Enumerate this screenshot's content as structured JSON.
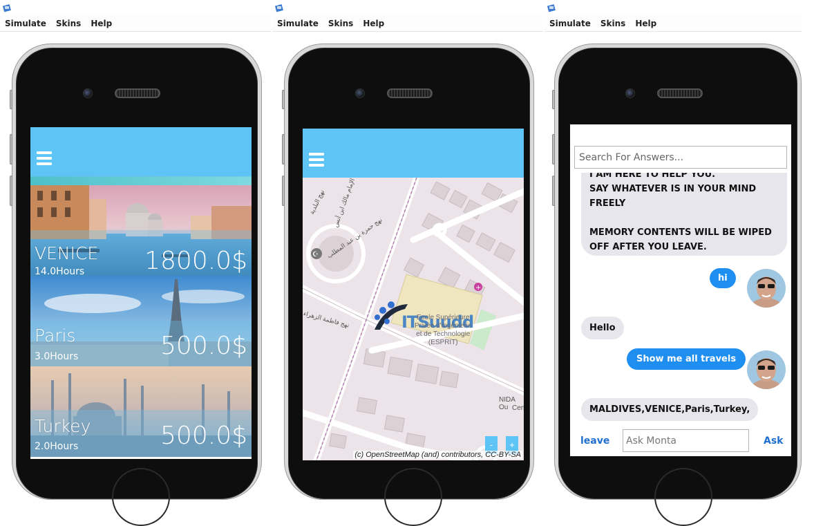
{
  "menu": [
    "Simulate",
    "Skins",
    "Help"
  ],
  "travels": [
    {
      "city": "VENICE",
      "hours": "14.0Hours",
      "price": "1800.0$"
    },
    {
      "city": "Paris",
      "hours": "3.0Hours",
      "price": "500.0$"
    },
    {
      "city": "Turkey",
      "hours": "2.0Hours",
      "price": "500.0$"
    }
  ],
  "map": {
    "zoom_out": "-",
    "zoom_in": "+",
    "attribution": "(c) OpenStreetMap (and) contributors, CC-BY-SA",
    "logo_text": "ITSuudd",
    "labels": {
      "school_1": "Ecole Supérieure",
      "school_2": "Privée d'Ingénierie",
      "school_3": "et de Technologie",
      "school_4": "(ESPRIT)",
      "nida": "NIDA Ou",
      "nida2": "Cen",
      "street_1": "نهج الإمام مالك ابن أنس",
      "street_2": "نهج البلدية",
      "street_3": "نهج حمزة بن عبد المطلب",
      "street_4": "نهج فاطمة الزهراء"
    }
  },
  "chat": {
    "search_placeholder": "Search For Answers...",
    "intro_lines": [
      "I AM HERE TO HELP YOU.",
      "SAY WHATEVER IS IN YOUR MIND",
      "FREELY",
      "",
      "MEMORY CONTENTS WILL BE WIPED",
      "OFF AFTER YOU LEAVE."
    ],
    "messages": [
      {
        "from": "user",
        "text": "hi"
      },
      {
        "from": "bot",
        "text": "Hello"
      },
      {
        "from": "user",
        "text": "Show me all travels"
      },
      {
        "from": "bot",
        "text": "MALDIVES,VENICE,Paris,Turkey,"
      }
    ],
    "leave_label": "leave",
    "ask_placeholder": "Ask Monta",
    "ask_label": "Ask"
  },
  "colors": {
    "app_bar": "#5ec3f5",
    "user_bubble": "#1e8ef0",
    "bot_bubble": "#e6e6ec",
    "link": "#1e6fd0"
  }
}
